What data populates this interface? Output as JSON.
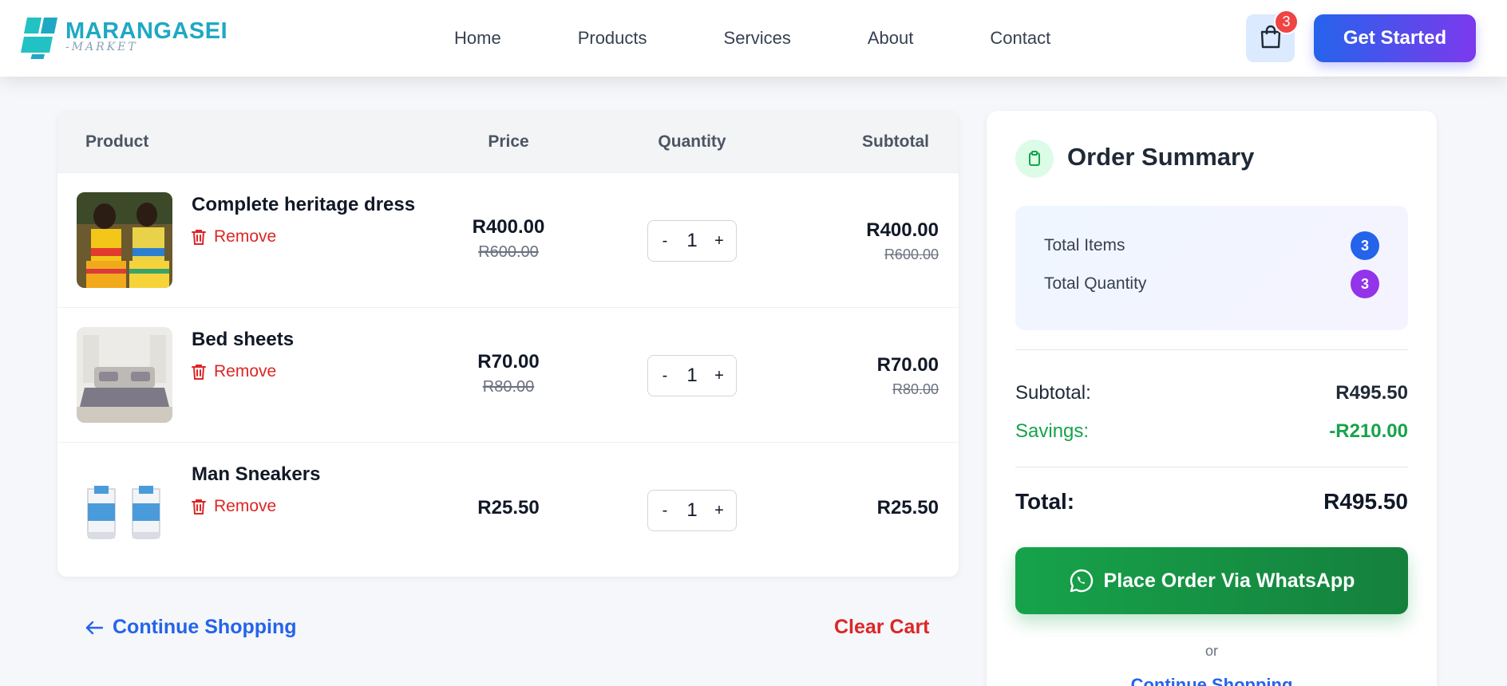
{
  "brand": {
    "name": "MARANGASEI",
    "sub": "-MARKET"
  },
  "nav": [
    "Home",
    "Products",
    "Services",
    "About",
    "Contact"
  ],
  "cart_badge": "3",
  "cta": "Get Started",
  "table": {
    "headers": {
      "product": "Product",
      "price": "Price",
      "quantity": "Quantity",
      "subtotal": "Subtotal"
    },
    "remove_label": "Remove",
    "items": [
      {
        "name": "Complete heritage dress",
        "price": "R400.00",
        "old_price": "R600.00",
        "qty": "1",
        "subtotal": "R400.00",
        "old_subtotal": "R600.00",
        "minus": "-",
        "plus": "+"
      },
      {
        "name": "Bed sheets",
        "price": "R70.00",
        "old_price": "R80.00",
        "qty": "1",
        "subtotal": "R70.00",
        "old_subtotal": "R80.00",
        "minus": "-",
        "plus": "+"
      },
      {
        "name": "Man Sneakers",
        "price": "R25.50",
        "qty": "1",
        "subtotal": "R25.50",
        "minus": "-",
        "plus": "+"
      }
    ]
  },
  "actions": {
    "continue": "Continue Shopping",
    "clear": "Clear Cart"
  },
  "summary": {
    "title": "Order Summary",
    "total_items_label": "Total Items",
    "total_items": "3",
    "total_qty_label": "Total Quantity",
    "total_qty": "3",
    "subtotal_label": "Subtotal:",
    "subtotal": "R495.50",
    "savings_label": "Savings:",
    "savings": "-R210.00",
    "total_label": "Total:",
    "total": "R495.50",
    "whatsapp": "Place Order Via WhatsApp",
    "or": "or",
    "continue": "Continue Shopping"
  },
  "colors": {
    "primary": "#2563eb",
    "danger": "#dc2626",
    "success": "#16a34a",
    "purple": "#9333ea"
  }
}
